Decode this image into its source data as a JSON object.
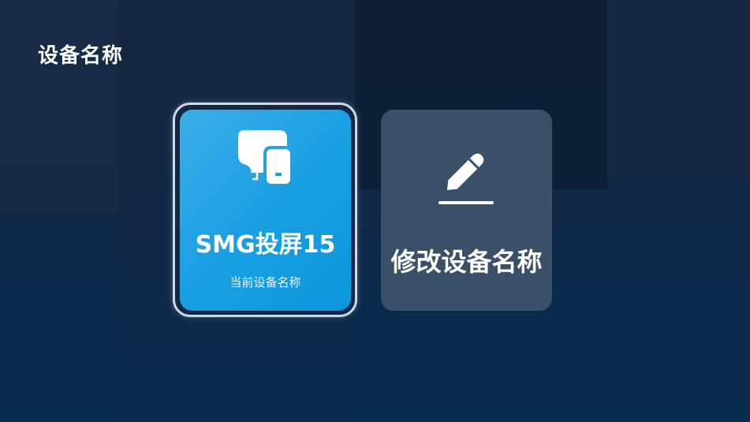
{
  "header": {
    "title": "设备名称"
  },
  "cards": {
    "current": {
      "name": "SMG投屏15",
      "subtitle": "当前设备名称",
      "icon": "cast-devices-icon",
      "color": "#1a9fe3"
    },
    "edit": {
      "label": "修改设备名称",
      "icon": "pencil-icon",
      "color": "#3a5068"
    }
  },
  "theme": {
    "background": "#0f2743",
    "accent": "#1a9fe3"
  }
}
